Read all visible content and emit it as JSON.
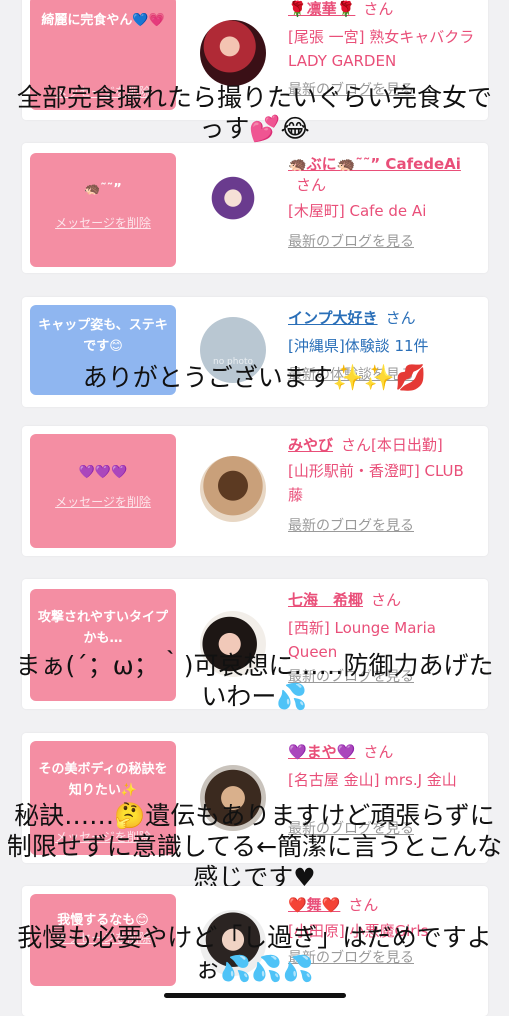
{
  "cards": [
    {
      "bubble_text": "綺麗に完食やん💙💗",
      "delete_label": "メッセージを削除",
      "name": "🌹凛華🌹",
      "san": "さん",
      "shop": "[尾張 一宮] 熟女キャバクラ LADY GARDEN",
      "blog_link": "最新のブログを見る",
      "overlay": "全部完食撮れたら撮りたいぐらい完食女でっす💕😂"
    },
    {
      "bubble_text": "🦔˜˜”",
      "delete_label": "メッセージを削除",
      "name": "🦔ぶに🦔˜˜” CafedeAi",
      "san": "さん",
      "shop": "[木屋町] Cafe de Ai",
      "blog_link": "最新のブログを見る"
    },
    {
      "bubble_text": "キャップ姿も、ステキです😊",
      "delete_label": "メッセージを削除",
      "name": "インプ大好き",
      "san": "さん",
      "shop": "[沖縄県]体験談 11件",
      "blog_link": "最新の体験談を見る",
      "avatar_caption": "no photo",
      "overlay": "ありがとうございます✨✨💋"
    },
    {
      "bubble_text": "💜💜💜",
      "delete_label": "メッセージを削除",
      "name": "みやび",
      "san": "さん[本日出勤]",
      "shop": "[山形駅前・香澄町] CLUB 藤",
      "blog_link": "最新のブログを見る"
    },
    {
      "bubble_text": "攻撃されやすいタイプかも…",
      "delete_label": "メッセージを削除",
      "name": "七海　希椰",
      "san": "さん",
      "shop": "[西新] Lounge Maria Queen",
      "blog_link": "最新のブログを見る",
      "overlay": "まぁ(´；ω；｀)可哀想に……防御力あげたいわー💦"
    },
    {
      "bubble_text": "その美ボディの秘訣を知りたい✨",
      "delete_label": "メッセージを削除",
      "name": "💜まや💜",
      "san": "さん",
      "shop": "[名古屋 金山] mrs.J 金山",
      "blog_link": "最新のブログを見る",
      "overlay": "秘訣……🤔遺伝もありますけど頑張らずに制限せずに意識してる←簡潔に言うとこんな感じです♥"
    },
    {
      "bubble_text": "我慢するなも😊",
      "delete_label": "メッセージを削除",
      "name": "❤️舞❤️",
      "san": "さん",
      "shop": "[小田原] 小悪魔Girls",
      "blog_link": "最新のブログを見る",
      "overlay": "我慢も必要やけど「し過ぎ」はだめですよぉ💦💦💦"
    }
  ],
  "colors": {
    "pink_bubble": "#f48ea3",
    "blue_bubble": "#8fb6f0",
    "name_pink": "#e94f79",
    "name_blue": "#2a6fb8"
  }
}
